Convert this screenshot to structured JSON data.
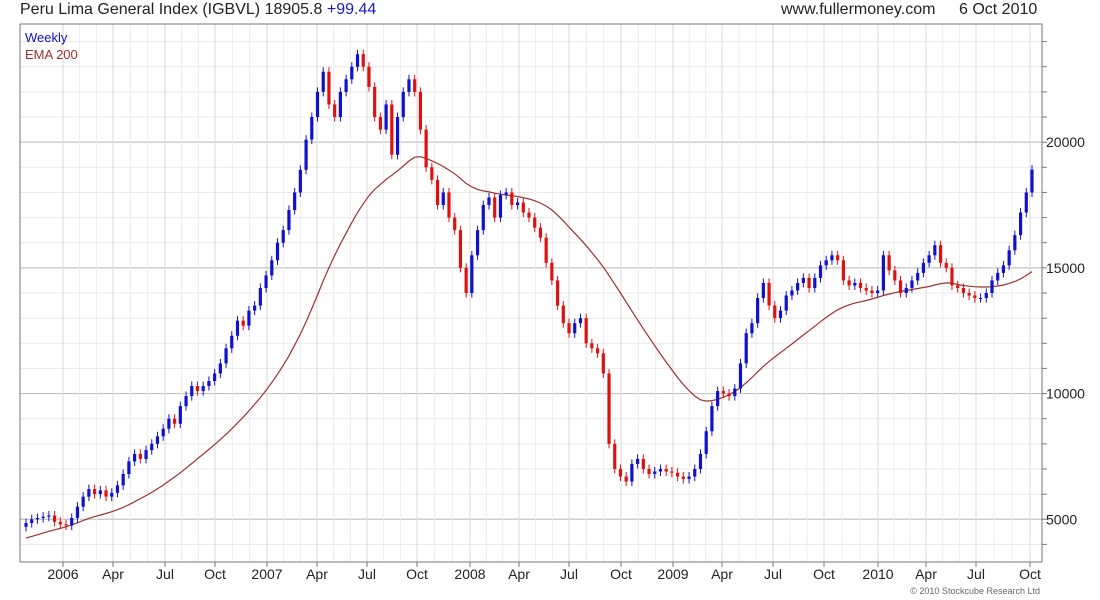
{
  "header": {
    "title": "Peru Lima General Index (IGBVL)",
    "price": "18905.8",
    "change": "+99.44",
    "site": "www.fullermoney.com",
    "date": "6 Oct 2010"
  },
  "copyright": "© 2010 Stockcube Research Ltd",
  "colors": {
    "up": "#1111cc",
    "down": "#dd1111",
    "ema": "#993333",
    "grid": "#d8d8d8",
    "frame": "#777777"
  },
  "chart_data": {
    "type": "candlestick",
    "title": "Peru Lima General Index (IGBVL)",
    "legend": [
      {
        "label": "Weekly",
        "color": "#1111cc"
      },
      {
        "label": "EMA 200",
        "color": "#993333"
      }
    ],
    "legend_position": "top-left",
    "y_axis_side": "right",
    "grid": true,
    "ylim": [
      3300,
      24700
    ],
    "y_ticks": [
      5000,
      10000,
      15000,
      20000
    ],
    "x_ticks": [
      "2006",
      "Apr",
      "Jul",
      "Oct",
      "2007",
      "Apr",
      "Jul",
      "Oct",
      "2008",
      "Apr",
      "Jul",
      "Oct",
      "2009",
      "Apr",
      "Jul",
      "Oct",
      "2010",
      "Apr",
      "Jul",
      "Oct"
    ],
    "series": [
      {
        "name": "Weekly",
        "close": [
          4850,
          5000,
          5050,
          5100,
          5150,
          4900,
          4800,
          4750,
          5050,
          5500,
          5900,
          6200,
          6000,
          6150,
          5900,
          6050,
          6350,
          6800,
          7300,
          7600,
          7400,
          7750,
          8000,
          8300,
          8600,
          9000,
          8800,
          9500,
          9900,
          10300,
          10100,
          10300,
          10500,
          10800,
          11200,
          11800,
          12300,
          12900,
          12700,
          13300,
          13500,
          14200,
          14700,
          15300,
          16000,
          16500,
          17300,
          18000,
          18900,
          20100,
          21000,
          22000,
          22800,
          21500,
          21000,
          22000,
          22500,
          23000,
          23500,
          23000,
          22200,
          21000,
          20500,
          21500,
          19500,
          21000,
          22000,
          22500,
          22000,
          20500,
          19000,
          18500,
          17500,
          18000,
          17000,
          16500,
          15000,
          14000,
          15500,
          16500,
          17500,
          17800,
          17000,
          17900,
          18000,
          17500,
          17600,
          17200,
          17000,
          16600,
          16200,
          15200,
          14500,
          13500,
          12800,
          12400,
          12800,
          13000,
          12000,
          11800,
          11600,
          10800,
          8000,
          7000,
          6700,
          6500,
          7200,
          7400,
          7000,
          6800,
          6900,
          7000,
          6900,
          6850,
          6700,
          6600,
          6700,
          7000,
          7600,
          8500,
          9500,
          10100,
          10000,
          9900,
          10200,
          11200,
          12400,
          12800,
          13800,
          14400,
          13500,
          13000,
          13300,
          13900,
          14100,
          14400,
          14600,
          14200,
          14600,
          15100,
          15300,
          15500,
          15300,
          14500,
          14300,
          14400,
          14200,
          14100,
          14000,
          14100,
          15500,
          14900,
          14500,
          14000,
          14200,
          14500,
          14800,
          15200,
          15500,
          15900,
          15200,
          15000,
          14300,
          14200,
          14000,
          13900,
          13800,
          13800,
          14000,
          14500,
          14800,
          15100,
          15700,
          16300,
          17200,
          18000,
          18906
        ]
      },
      {
        "name": "EMA 200",
        "values": [
          4250,
          4320,
          4380,
          4450,
          4520,
          4580,
          4640,
          4700,
          4780,
          4860,
          4950,
          5040,
          5100,
          5170,
          5230,
          5300,
          5380,
          5470,
          5580,
          5700,
          5820,
          5940,
          6070,
          6210,
          6360,
          6520,
          6680,
          6850,
          7030,
          7220,
          7410,
          7590,
          7780,
          7970,
          8170,
          8380,
          8600,
          8830,
          9060,
          9310,
          9570,
          9840,
          10130,
          10440,
          10770,
          11120,
          11500,
          11920,
          12370,
          12860,
          13380,
          13920,
          14480,
          15000,
          15500,
          15950,
          16380,
          16800,
          17200,
          17550,
          17870,
          18120,
          18320,
          18520,
          18680,
          18860,
          19050,
          19250,
          19400,
          19420,
          19350,
          19260,
          19150,
          19030,
          18890,
          18740,
          18560,
          18360,
          18220,
          18120,
          18060,
          18020,
          17970,
          17930,
          17900,
          17870,
          17840,
          17790,
          17740,
          17670,
          17580,
          17460,
          17300,
          17100,
          16870,
          16620,
          16380,
          16140,
          15880,
          15610,
          15330,
          15030,
          14700,
          14350,
          14000,
          13640,
          13280,
          12930,
          12580,
          12240,
          11900,
          11570,
          11250,
          10940,
          10640,
          10360,
          10120,
          9900,
          9750,
          9700,
          9720,
          9770,
          9850,
          9950,
          10080,
          10240,
          10430,
          10640,
          10860,
          11080,
          11280,
          11460,
          11630,
          11800,
          11970,
          12150,
          12330,
          12500,
          12680,
          12860,
          13030,
          13190,
          13330,
          13440,
          13530,
          13600,
          13650,
          13700,
          13760,
          13830,
          13900,
          13960,
          14010,
          14060,
          14100,
          14140,
          14180,
          14220,
          14260,
          14320,
          14370,
          14400,
          14390,
          14340,
          14300,
          14270,
          14250,
          14240,
          14240,
          14250,
          14280,
          14320,
          14380,
          14460,
          14560,
          14700,
          14850
        ]
      }
    ]
  }
}
